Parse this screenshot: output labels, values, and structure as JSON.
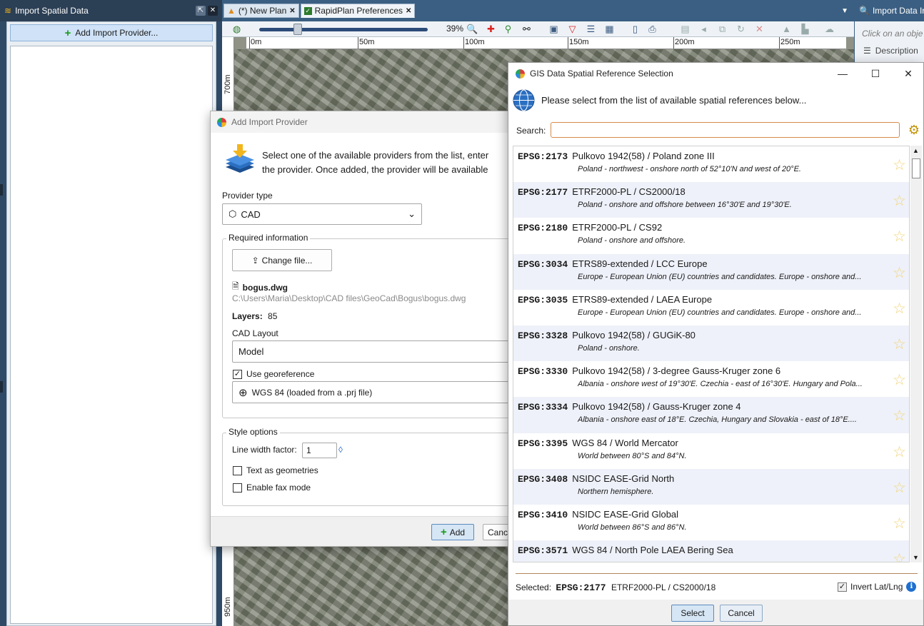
{
  "left_pane": {
    "title": "Import Spatial Data",
    "add_provider_label": "Add Import Provider..."
  },
  "tabs": [
    {
      "label": "(*) New Plan"
    },
    {
      "label": "RapidPlan Preferences"
    }
  ],
  "right_pane": {
    "title": "Import Data Ir",
    "hint": "Click on an obje",
    "description_label": "Description"
  },
  "map": {
    "zoom_label": "39%",
    "ruler_h_labels": [
      "0m",
      "50m",
      "100m",
      "150m",
      "200m",
      "250m"
    ],
    "ruler_v_labels": [
      "700m",
      "950m"
    ]
  },
  "add_import_provider": {
    "title": "Add Import Provider",
    "intro_line1": "Select one of the available providers from the list, enter",
    "intro_line2": "the provider. Once added, the provider will be available",
    "provider_type_label": "Provider type",
    "provider_type_value": "CAD",
    "required_info_label": "Required information",
    "change_file_label": "Change file...",
    "file_name": "bogus.dwg",
    "file_path": "C:\\Users\\Maria\\Desktop\\CAD files\\GeoCad\\Bogus\\bogus.dwg",
    "layers_label": "Layers:",
    "layers_value": "85",
    "cad_layout_label": "CAD Layout",
    "cad_layout_value": "Model",
    "use_georeference_label": "Use georeference",
    "use_georeference_checked": true,
    "georeference_value": "WGS 84 (loaded from a .prj file)",
    "style_options_label": "Style options",
    "line_width_label": "Line width factor:",
    "line_width_value": "1",
    "text_as_geometries_label": "Text as geometries",
    "enable_fax_label": "Enable fax mode",
    "add_label": "Add",
    "cancel_label": "Cance"
  },
  "gis_dialog": {
    "title": "GIS Data Spatial Reference Selection",
    "prompt": "Please select from the list of available spatial references below...",
    "search_label": "Search:",
    "search_value": "",
    "items": [
      {
        "code": "EPSG:2173",
        "name": "Pulkovo 1942(58) / Poland zone III",
        "area": "Poland - northwest - onshore north of 52°10'N and west of 20°E."
      },
      {
        "code": "EPSG:2177",
        "name": "ETRF2000-PL / CS2000/18",
        "area": "Poland - onshore and offshore between 16°30'E and 19°30'E."
      },
      {
        "code": "EPSG:2180",
        "name": "ETRF2000-PL / CS92",
        "area": "Poland - onshore and offshore."
      },
      {
        "code": "EPSG:3034",
        "name": "ETRS89-extended / LCC Europe",
        "area": "Europe - European Union (EU) countries and candidates. Europe - onshore and..."
      },
      {
        "code": "EPSG:3035",
        "name": "ETRS89-extended / LAEA Europe",
        "area": "Europe - European Union (EU) countries and candidates. Europe - onshore and..."
      },
      {
        "code": "EPSG:3328",
        "name": "Pulkovo 1942(58) / GUGiK-80",
        "area": "Poland - onshore."
      },
      {
        "code": "EPSG:3330",
        "name": "Pulkovo 1942(58) / 3-degree Gauss-Kruger zone 6",
        "area": "Albania - onshore west of 19°30'E. Czechia - east of 16°30'E. Hungary and Pola..."
      },
      {
        "code": "EPSG:3334",
        "name": "Pulkovo 1942(58) / Gauss-Kruger zone 4",
        "area": "Albania - onshore east of 18°E. Czechia, Hungary and Slovakia - east of 18°E...."
      },
      {
        "code": "EPSG:3395",
        "name": "WGS 84 / World Mercator",
        "area": "World between 80°S and 84°N."
      },
      {
        "code": "EPSG:3408",
        "name": "NSIDC EASE-Grid North",
        "area": "Northern hemisphere."
      },
      {
        "code": "EPSG:3410",
        "name": "NSIDC EASE-Grid Global",
        "area": "World between 86°S and 86°N."
      },
      {
        "code": "EPSG:3571",
        "name": "WGS 84 / North Pole LAEA Bering Sea",
        "area": ""
      }
    ],
    "selected_label": "Selected:",
    "selected_code": "EPSG:2177",
    "selected_name": "ETRF2000-PL / CS2000/18",
    "invert_label": "Invert Lat/Lng",
    "invert_checked": true,
    "select_label": "Select",
    "cancel_label": "Cancel"
  }
}
